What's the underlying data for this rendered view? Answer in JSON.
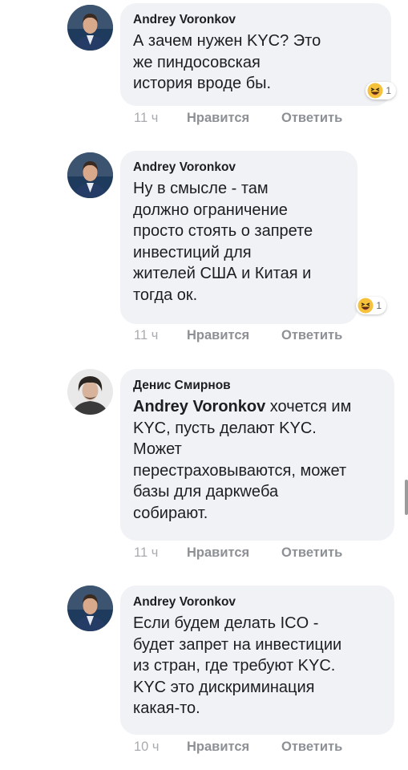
{
  "comments": [
    {
      "author": "Andrey Voronkov",
      "mention": "",
      "text": "А зачем нужен KYC? Это\nже пиндосовская\nистория вроде бы.",
      "reaction_icon": "haha-emoji-icon",
      "reaction_count": "1",
      "time": "11 ч",
      "like_label": "Нравится",
      "reply_label": "Ответить"
    },
    {
      "author": "Andrey Voronkov",
      "mention": "",
      "text": "Ну в смысле - там\nдолжно ограничение\nпросто стоять о запрете\nинвестиций для\nжителей США и Китая и\nтогда ок.",
      "reaction_icon": "haha-emoji-icon",
      "reaction_count": "1",
      "time": "11 ч",
      "like_label": "Нравится",
      "reply_label": "Ответить"
    },
    {
      "author": "Денис Смирнов",
      "mention": "Andrey Voronkov",
      "text": " хочется им\nKYC, пусть делают KYC.\nМожет\nперестраховываются, может\nбазы для даркweба\nсобирают.",
      "time": "11 ч",
      "like_label": "Нравится",
      "reply_label": "Ответить"
    },
    {
      "author": "Andrey Voronkov",
      "mention": "",
      "text": "Если будем делать ICO -\nбудет запрет на инвестиции\nиз стран, где требуют KYC.\nKYC это дискриминация\nкакая-то.",
      "time": "10 ч",
      "like_label": "Нравится",
      "reply_label": "Ответить"
    }
  ],
  "colors": {
    "bubble": "#f1f2f5",
    "action_text": "#8d9094",
    "emoji_yellow": "#f7c23b"
  }
}
